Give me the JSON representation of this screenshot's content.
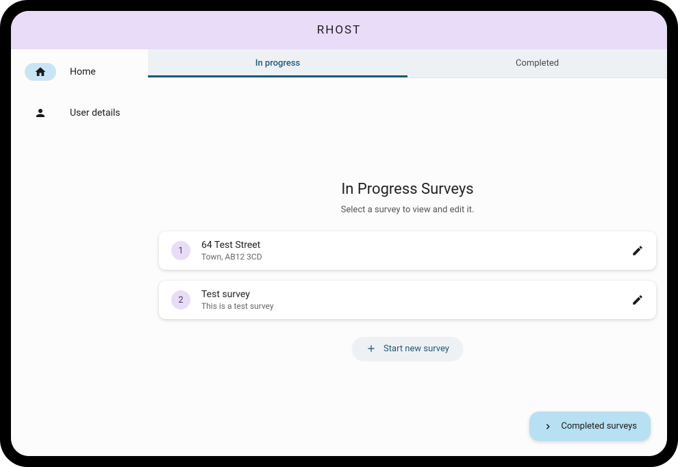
{
  "header": {
    "title": "RHOST"
  },
  "sidebar": {
    "items": [
      {
        "label": "Home",
        "active": true
      },
      {
        "label": "User details",
        "active": false
      }
    ]
  },
  "tabs": [
    {
      "label": "In progress",
      "active": true
    },
    {
      "label": "Completed",
      "active": false
    }
  ],
  "section": {
    "title": "In Progress Surveys",
    "subtitle": "Select a survey to view and edit it."
  },
  "surveys": [
    {
      "num": "1",
      "title": "64 Test Street",
      "subtitle": "Town, AB12 3CD"
    },
    {
      "num": "2",
      "title": "Test survey",
      "subtitle": "This is a test survey"
    }
  ],
  "start_button": {
    "label": "Start new survey"
  },
  "completed_button": {
    "label": "Completed surveys"
  }
}
